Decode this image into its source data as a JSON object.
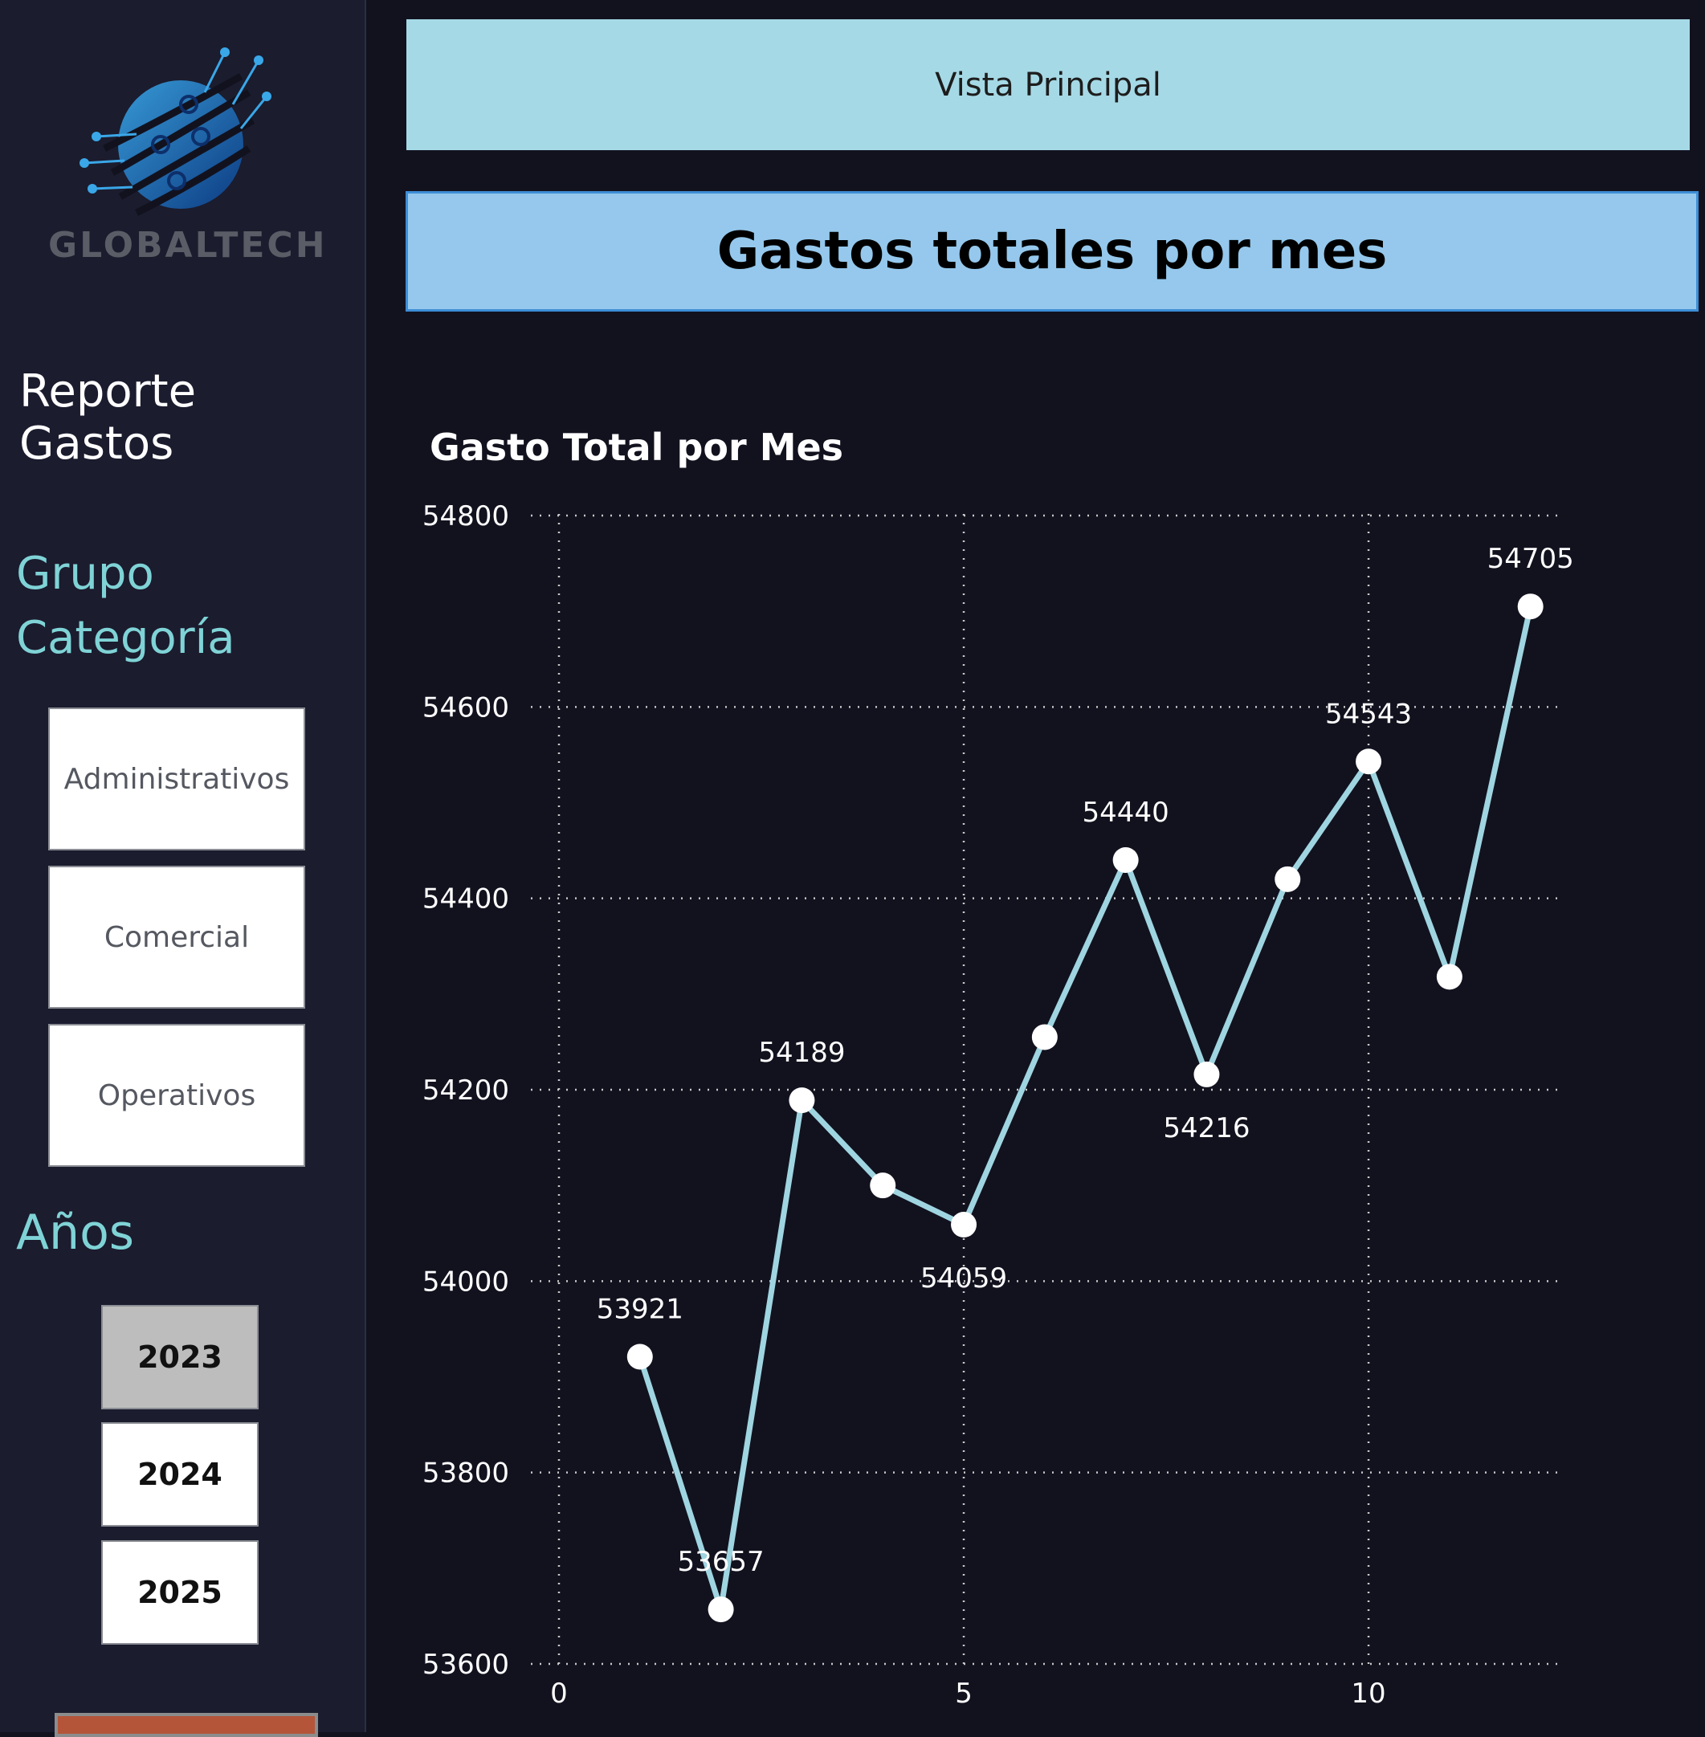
{
  "sidebar": {
    "logo_text": "GLOBALTECH",
    "report_title": "Reporte Gastos",
    "group_title": [
      "Grupo",
      "Categoría"
    ],
    "categories": [
      "Administrativos",
      "Comercial",
      "Operativos"
    ],
    "years_title": "Años",
    "years": [
      {
        "label": "2023",
        "selected": true
      },
      {
        "label": "2024",
        "selected": false
      },
      {
        "label": "2025",
        "selected": false
      }
    ]
  },
  "nav": {
    "main_view_label": "Vista Principal"
  },
  "header": {
    "title": "Gastos totales por mes"
  },
  "colors": {
    "background": "#12121f",
    "sidebar": "#1b1c2e",
    "accent_teal": "#7fd3d6",
    "line": "#9fd5e1",
    "marker": "#ffffff",
    "nav_banner": "#a6d9e6",
    "header_banner": "#95c8ec"
  },
  "chart_data": {
    "type": "line",
    "title": "Gasto Total por Mes",
    "xlabel": "",
    "ylabel": "",
    "x": [
      1,
      2,
      3,
      4,
      5,
      6,
      7,
      8,
      9,
      10,
      11,
      12
    ],
    "series": [
      {
        "values": [
          53921,
          53657,
          54189,
          54100,
          54059,
          54255,
          54440,
          54216,
          54420,
          54543,
          54318,
          54705
        ]
      }
    ],
    "data_labels": [
      {
        "x": 1,
        "text": "53921"
      },
      {
        "x": 2,
        "text": "53657"
      },
      {
        "x": 3,
        "text": "54189"
      },
      {
        "x": 5,
        "text": "54059"
      },
      {
        "x": 7,
        "text": "54440"
      },
      {
        "x": 8,
        "text": "54216"
      },
      {
        "x": 10,
        "text": "54543"
      },
      {
        "x": 12,
        "text": "54705"
      }
    ],
    "xlim": [
      0,
      12.4
    ],
    "ylim": [
      53600,
      54800
    ],
    "x_ticks": [
      0,
      5,
      10
    ],
    "y_ticks": [
      53600,
      53800,
      54000,
      54200,
      54400,
      54600,
      54800
    ],
    "grid": true
  }
}
